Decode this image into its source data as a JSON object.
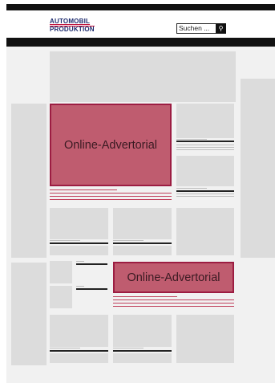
{
  "header": {
    "logo_line1": "AUTOMOBIL",
    "logo_line2": "PRODUKTION",
    "search_placeholder": "Suchen ...",
    "search_icon": "magnifier-icon"
  },
  "ads": {
    "primary_label": "Online-Advertorial",
    "secondary_label": "Online-Advertorial"
  },
  "colors": {
    "ad_fill": "#bf5c6f",
    "ad_border": "#9c1d42",
    "brand_navy": "#1d2b6e",
    "brand_red": "#c0143c"
  }
}
